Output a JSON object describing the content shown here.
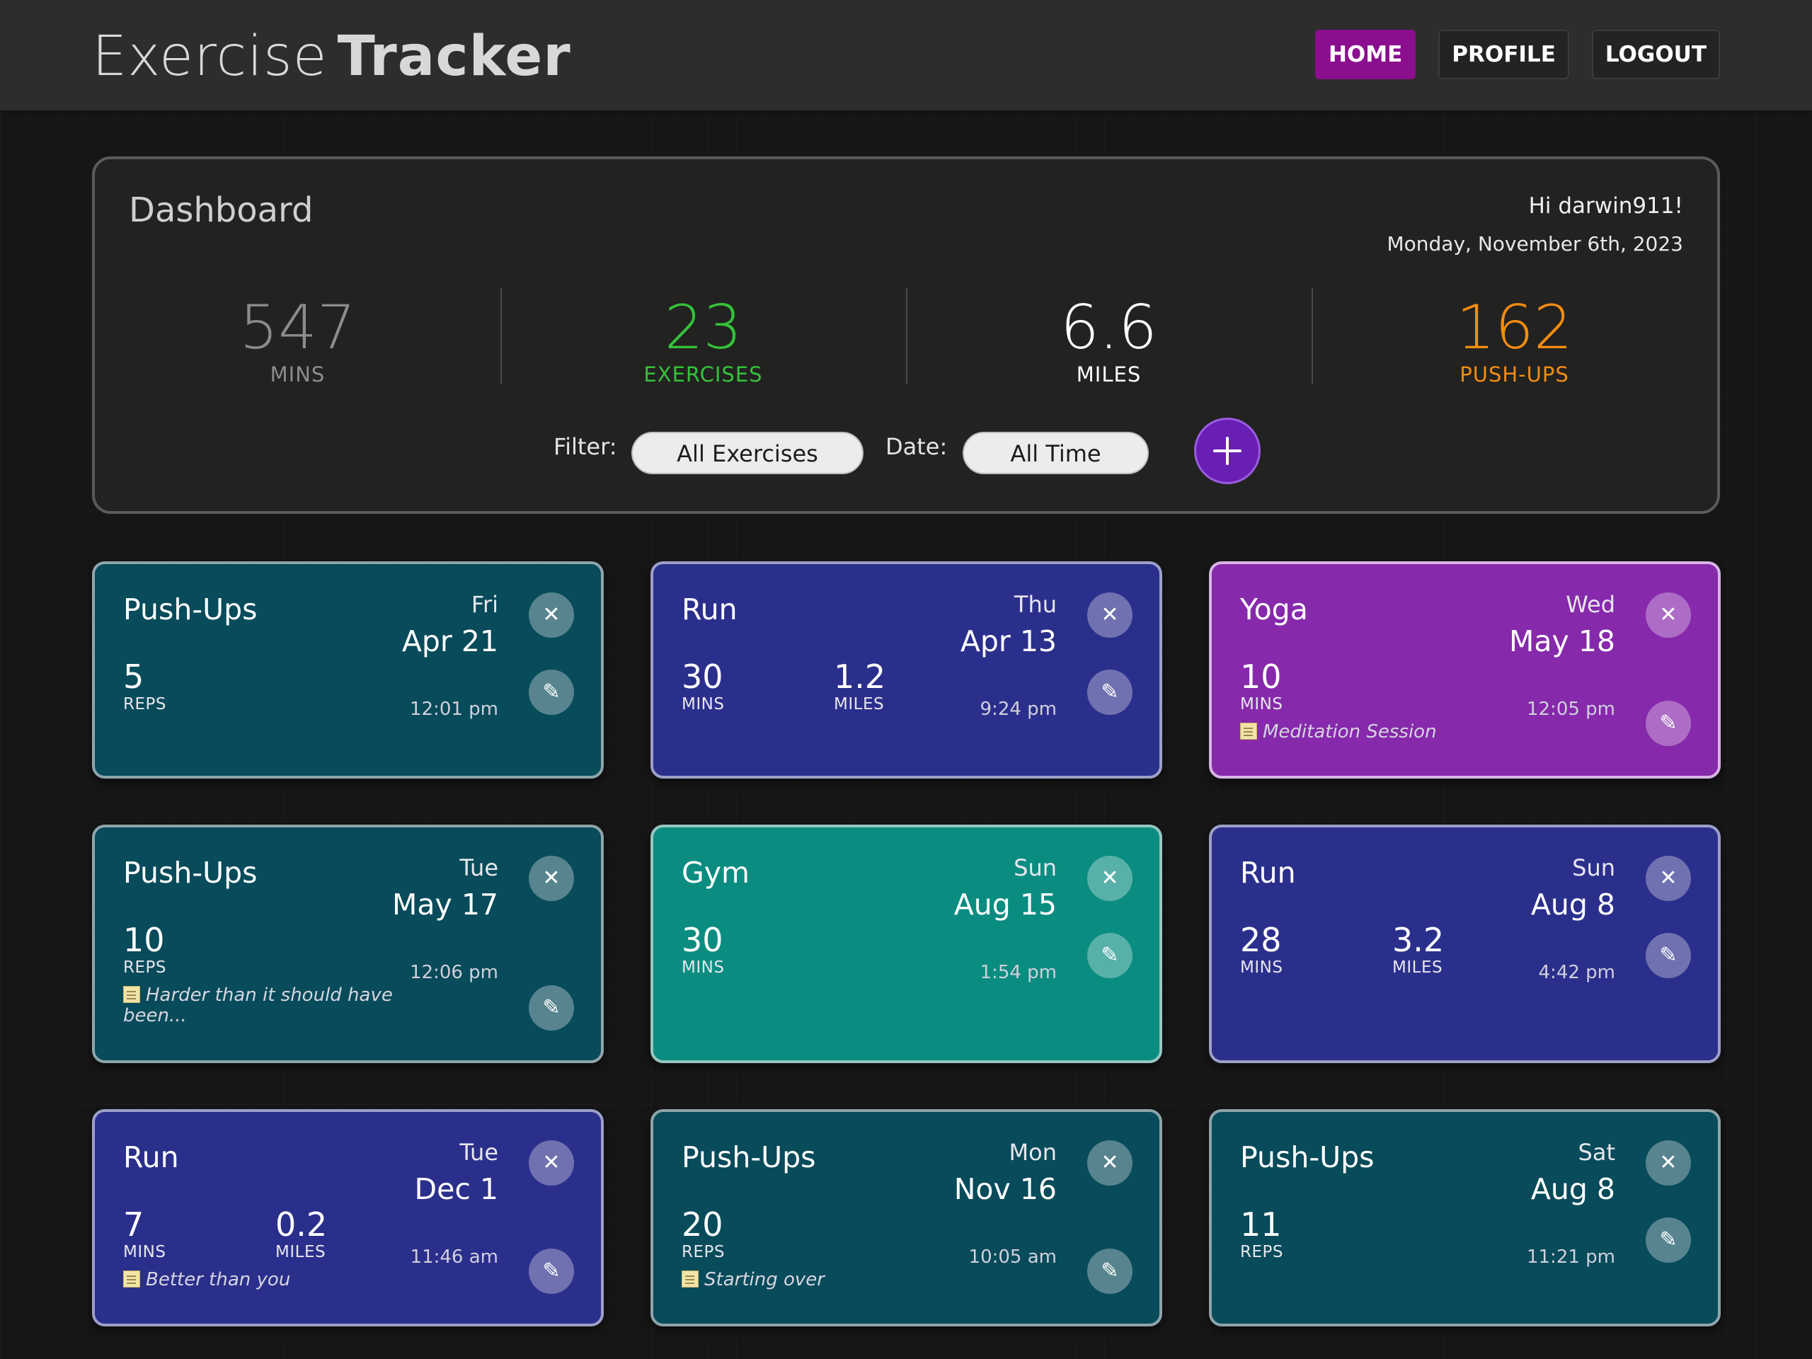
{
  "app": {
    "title_light": "Exercise",
    "title_bold": "Tracker"
  },
  "nav": {
    "home": "HOME",
    "profile": "PROFILE",
    "logout": "LOGOUT"
  },
  "dashboard": {
    "title": "Dashboard",
    "greeting": "Hi darwin911!",
    "date": "Monday, November 6th, 2023",
    "stats": [
      {
        "value": "547",
        "label": "MINS",
        "color": "#8c8c8c"
      },
      {
        "value": "23",
        "label": "EXERCISES",
        "color": "#35c23a"
      },
      {
        "value": "6.6",
        "label": "MILES",
        "color": "#ffffff"
      },
      {
        "value": "162",
        "label": "PUSH-UPS",
        "color": "#f28c12"
      }
    ],
    "filter_label": "Filter:",
    "filter_value": "All Exercises",
    "date_label": "Date:",
    "date_value": "All Time",
    "add_icon": "plus-icon"
  },
  "colors": {
    "accent_nav": "#8a0e8e",
    "add_button": "#6a1fb4",
    "teal_card": "#084b5a",
    "indigo_card": "#2b2f8c",
    "purple_card": "#8629ab",
    "green_card": "#0a8d80"
  },
  "cards": [
    {
      "name": "Push-Ups",
      "dow": "Fri",
      "date": "Apr 21",
      "time": "12:01 pm",
      "metrics": [
        {
          "value": "5",
          "unit": "REPS"
        }
      ],
      "note": ""
    },
    {
      "name": "Run",
      "dow": "Thu",
      "date": "Apr 13",
      "time": "9:24 pm",
      "metrics": [
        {
          "value": "30",
          "unit": "MINS"
        },
        {
          "value": "1.2",
          "unit": "MILES"
        }
      ],
      "note": ""
    },
    {
      "name": "Yoga",
      "dow": "Wed",
      "date": "May 18",
      "time": "12:05 pm",
      "metrics": [
        {
          "value": "10",
          "unit": "MINS"
        }
      ],
      "note": "Meditation Session"
    },
    {
      "name": "Push-Ups",
      "dow": "Tue",
      "date": "May 17",
      "time": "12:06 pm",
      "metrics": [
        {
          "value": "10",
          "unit": "REPS"
        }
      ],
      "note": "Harder than it should have been..."
    },
    {
      "name": "Gym",
      "dow": "Sun",
      "date": "Aug 15",
      "time": "1:54 pm",
      "metrics": [
        {
          "value": "30",
          "unit": "MINS"
        }
      ],
      "note": ""
    },
    {
      "name": "Run",
      "dow": "Sun",
      "date": "Aug 8",
      "time": "4:42 pm",
      "metrics": [
        {
          "value": "28",
          "unit": "MINS"
        },
        {
          "value": "3.2",
          "unit": "MILES"
        }
      ],
      "note": ""
    },
    {
      "name": "Run",
      "dow": "Tue",
      "date": "Dec 1",
      "time": "11:46 am",
      "metrics": [
        {
          "value": "7",
          "unit": "MINS"
        },
        {
          "value": "0.2",
          "unit": "MILES"
        }
      ],
      "note": "Better than you"
    },
    {
      "name": "Push-Ups",
      "dow": "Mon",
      "date": "Nov 16",
      "time": "10:05 am",
      "metrics": [
        {
          "value": "20",
          "unit": "REPS"
        }
      ],
      "note": "Starting over"
    },
    {
      "name": "Push-Ups",
      "dow": "Sat",
      "date": "Aug 8",
      "time": "11:21 pm",
      "metrics": [
        {
          "value": "11",
          "unit": "REPS"
        }
      ],
      "note": ""
    }
  ],
  "icons": {
    "close": "close-icon",
    "edit": "pencil-icon",
    "note": "notepad-icon"
  }
}
